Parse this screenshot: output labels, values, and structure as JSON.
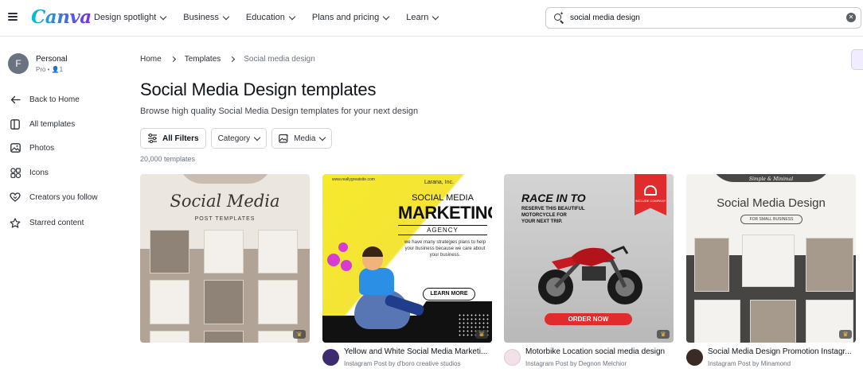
{
  "nav": {
    "logo": "Canva",
    "menu": [
      {
        "label": "Design spotlight"
      },
      {
        "label": "Business"
      },
      {
        "label": "Education"
      },
      {
        "label": "Plans and pricing"
      },
      {
        "label": "Learn"
      }
    ]
  },
  "search": {
    "value": "social media design"
  },
  "account": {
    "initial": "F",
    "name": "Personal",
    "plan": "Pro",
    "members": "1"
  },
  "sidebar": {
    "items": [
      {
        "label": "Back to Home",
        "icon": "arrow-left-icon"
      },
      {
        "label": "All templates",
        "icon": "templates-icon"
      },
      {
        "label": "Photos",
        "icon": "photo-icon"
      },
      {
        "label": "Icons",
        "icon": "shapes-icon"
      },
      {
        "label": "Creators you follow",
        "icon": "heart-icon"
      },
      {
        "label": "Starred content",
        "icon": "star-icon"
      }
    ]
  },
  "breadcrumb": [
    "Home",
    "Templates",
    "Social media design"
  ],
  "page": {
    "title": "Social Media Design templates",
    "subtitle": "Browse high quality Social Media Design templates for your next design",
    "count": "20,000 templates"
  },
  "filters": {
    "all": "All Filters",
    "category": "Category",
    "media": "Media"
  },
  "cards": [
    {
      "title": "",
      "subtitle": "",
      "thumb": {
        "script": "Social Media",
        "small": "POST TEMPLATES"
      }
    },
    {
      "title": "Yellow and White Social Media Marketi...",
      "subtitle": "Instagram Post by d'boro creative studios",
      "avatar_color": "#3c2b6e",
      "thumb": {
        "url": "www.reallygreatsite.com",
        "brand": "Larana, Inc.",
        "h1": "SOCIAL MEDIA",
        "h2": "MARKETING",
        "h3": "AGENCY",
        "body": "we have many strategies plans to help your business because we care about your business.",
        "cta": "LEARN MORE"
      }
    },
    {
      "title": "Motorbike Location social media design",
      "subtitle": "Instagram Post by Degnon Melchior",
      "avatar_color": "#f1e2ea",
      "thumb": {
        "h1": "RACE IN TO",
        "body_lines": [
          "RESERVE THIS BEAUTIFUL",
          "MOTORCYCLE FOR",
          "YOUR NEXT TRIP."
        ],
        "ribbon": "INCLUDE COMPANY",
        "cta": "ORDER NOW"
      }
    },
    {
      "title": "Social Media Design Promotion Instagr...",
      "subtitle": "Instagram Post by Minamond",
      "avatar_color": "#3b2a23",
      "thumb": {
        "script": "Simple & Minimal",
        "h1": "Social Media Design",
        "pill": "FOR SMALL BUSINESS"
      }
    }
  ]
}
